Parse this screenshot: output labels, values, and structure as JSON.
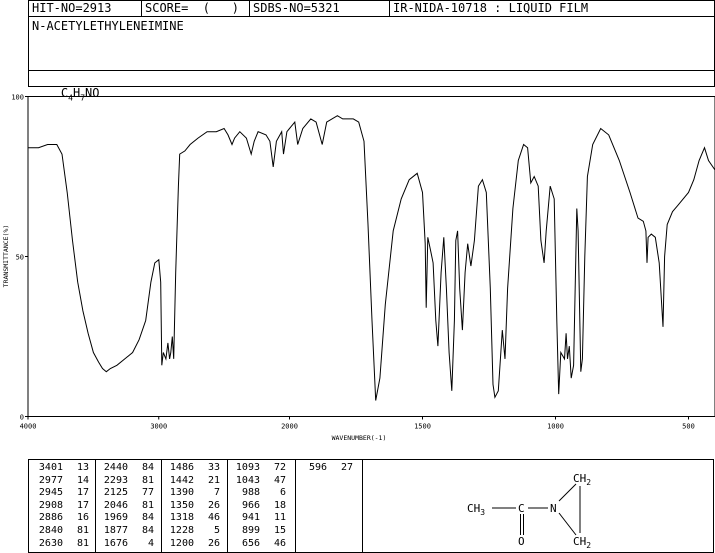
{
  "header": {
    "hit_no": "HIT-NO=2913",
    "score": "SCORE=  (   )",
    "sdbs_no": "SDBS-NO=5321",
    "ir_info": "IR-NIDA-10718 : LIQUID FILM"
  },
  "compound_name": "N-ACETYLETHYLENEIMINE",
  "formula": {
    "c": "C",
    "c_n": "4",
    "h": "H",
    "h_n": "7",
    "rest": "NO"
  },
  "structure": {
    "ch3": "CH",
    "ch3_sub": "3",
    "c": "C",
    "o": "O",
    "n": "N",
    "ch2_top": "CH",
    "ch2_top_sub": "2",
    "ch2_bot": "CH",
    "ch2_bot_sub": "2"
  },
  "chart_data": {
    "type": "line",
    "xlabel": "WAVENUMBER(-1)",
    "ylabel": "TRANSMITTANCE(%)",
    "xlim": [
      4000,
      400
    ],
    "ylim": [
      0,
      100
    ],
    "x_ticks": [
      "4000",
      "3000",
      "2000",
      "1500",
      "1000",
      "500"
    ],
    "y_ticks": [
      "100",
      "50",
      "0"
    ],
    "series": [
      {
        "points": [
          [
            4000,
            84
          ],
          [
            3920,
            84
          ],
          [
            3850,
            85
          ],
          [
            3780,
            85
          ],
          [
            3740,
            82
          ],
          [
            3700,
            70
          ],
          [
            3660,
            55
          ],
          [
            3620,
            42
          ],
          [
            3580,
            33
          ],
          [
            3540,
            26
          ],
          [
            3500,
            20
          ],
          [
            3460,
            17
          ],
          [
            3430,
            15
          ],
          [
            3401,
            14
          ],
          [
            3370,
            15
          ],
          [
            3320,
            16
          ],
          [
            3260,
            18
          ],
          [
            3200,
            20
          ],
          [
            3150,
            24
          ],
          [
            3100,
            30
          ],
          [
            3060,
            42
          ],
          [
            3030,
            48
          ],
          [
            3000,
            49
          ],
          [
            2985,
            42
          ],
          [
            2977,
            16
          ],
          [
            2965,
            20
          ],
          [
            2955,
            19
          ],
          [
            2945,
            18
          ],
          [
            2930,
            23
          ],
          [
            2917,
            18
          ],
          [
            2908,
            20
          ],
          [
            2896,
            25
          ],
          [
            2886,
            18
          ],
          [
            2870,
            45
          ],
          [
            2850,
            72
          ],
          [
            2840,
            82
          ],
          [
            2800,
            83
          ],
          [
            2760,
            85
          ],
          [
            2700,
            87
          ],
          [
            2630,
            89
          ],
          [
            2560,
            89
          ],
          [
            2500,
            90
          ],
          [
            2470,
            88
          ],
          [
            2440,
            85
          ],
          [
            2420,
            87
          ],
          [
            2380,
            89
          ],
          [
            2330,
            87
          ],
          [
            2293,
            82
          ],
          [
            2270,
            86
          ],
          [
            2240,
            89
          ],
          [
            2180,
            88
          ],
          [
            2150,
            86
          ],
          [
            2125,
            78
          ],
          [
            2100,
            86
          ],
          [
            2060,
            89
          ],
          [
            2046,
            82
          ],
          [
            2020,
            89
          ],
          [
            2000,
            90
          ],
          [
            1980,
            92
          ],
          [
            1969,
            85
          ],
          [
            1950,
            90
          ],
          [
            1920,
            93
          ],
          [
            1900,
            92
          ],
          [
            1877,
            85
          ],
          [
            1860,
            92
          ],
          [
            1820,
            94
          ],
          [
            1800,
            93
          ],
          [
            1760,
            93
          ],
          [
            1740,
            92
          ],
          [
            1720,
            86
          ],
          [
            1705,
            60
          ],
          [
            1690,
            30
          ],
          [
            1676,
            5
          ],
          [
            1660,
            12
          ],
          [
            1640,
            35
          ],
          [
            1610,
            58
          ],
          [
            1580,
            68
          ],
          [
            1550,
            74
          ],
          [
            1520,
            76
          ],
          [
            1500,
            70
          ],
          [
            1490,
            54
          ],
          [
            1486,
            34
          ],
          [
            1480,
            56
          ],
          [
            1470,
            52
          ],
          [
            1460,
            48
          ],
          [
            1450,
            30
          ],
          [
            1442,
            22
          ],
          [
            1430,
            45
          ],
          [
            1420,
            56
          ],
          [
            1410,
            40
          ],
          [
            1400,
            20
          ],
          [
            1390,
            8
          ],
          [
            1380,
            30
          ],
          [
            1375,
            55
          ],
          [
            1368,
            58
          ],
          [
            1360,
            40
          ],
          [
            1350,
            27
          ],
          [
            1340,
            45
          ],
          [
            1330,
            54
          ],
          [
            1318,
            47
          ],
          [
            1305,
            55
          ],
          [
            1290,
            72
          ],
          [
            1275,
            74
          ],
          [
            1260,
            70
          ],
          [
            1245,
            40
          ],
          [
            1235,
            10
          ],
          [
            1228,
            6
          ],
          [
            1215,
            8
          ],
          [
            1200,
            27
          ],
          [
            1190,
            18
          ],
          [
            1180,
            40
          ],
          [
            1160,
            65
          ],
          [
            1140,
            80
          ],
          [
            1120,
            85
          ],
          [
            1105,
            84
          ],
          [
            1093,
            73
          ],
          [
            1080,
            75
          ],
          [
            1065,
            72
          ],
          [
            1055,
            55
          ],
          [
            1043,
            48
          ],
          [
            1035,
            58
          ],
          [
            1020,
            72
          ],
          [
            1005,
            68
          ],
          [
            995,
            30
          ],
          [
            988,
            7
          ],
          [
            980,
            20
          ],
          [
            966,
            18
          ],
          [
            960,
            26
          ],
          [
            955,
            18
          ],
          [
            948,
            22
          ],
          [
            941,
            12
          ],
          [
            932,
            16
          ],
          [
            920,
            65
          ],
          [
            915,
            58
          ],
          [
            905,
            14
          ],
          [
            899,
            18
          ],
          [
            890,
            50
          ],
          [
            880,
            75
          ],
          [
            860,
            85
          ],
          [
            830,
            90
          ],
          [
            800,
            88
          ],
          [
            760,
            80
          ],
          [
            720,
            70
          ],
          [
            690,
            62
          ],
          [
            670,
            61
          ],
          [
            660,
            58
          ],
          [
            656,
            48
          ],
          [
            652,
            56
          ],
          [
            640,
            57
          ],
          [
            625,
            56
          ],
          [
            610,
            48
          ],
          [
            596,
            28
          ],
          [
            590,
            50
          ],
          [
            580,
            60
          ],
          [
            560,
            64
          ],
          [
            540,
            66
          ],
          [
            500,
            70
          ],
          [
            480,
            74
          ],
          [
            460,
            80
          ],
          [
            440,
            84
          ],
          [
            425,
            80
          ],
          [
            400,
            77
          ]
        ]
      }
    ]
  },
  "peaks": [
    [
      [
        "3401",
        "13"
      ],
      [
        "2977",
        "14"
      ],
      [
        "2945",
        "17"
      ],
      [
        "2908",
        "17"
      ],
      [
        "2886",
        "16"
      ],
      [
        "2840",
        "81"
      ],
      [
        "2630",
        "81"
      ]
    ],
    [
      [
        "2440",
        "84"
      ],
      [
        "2293",
        "81"
      ],
      [
        "2125",
        "77"
      ],
      [
        "2046",
        "81"
      ],
      [
        "1969",
        "84"
      ],
      [
        "1877",
        "84"
      ],
      [
        "1676",
        "4"
      ]
    ],
    [
      [
        "1486",
        "33"
      ],
      [
        "1442",
        "21"
      ],
      [
        "1390",
        "7"
      ],
      [
        "1350",
        "26"
      ],
      [
        "1318",
        "46"
      ],
      [
        "1228",
        "5"
      ],
      [
        "1200",
        "26"
      ]
    ],
    [
      [
        "1093",
        "72"
      ],
      [
        "1043",
        "47"
      ],
      [
        "988",
        "6"
      ],
      [
        "966",
        "18"
      ],
      [
        "941",
        "11"
      ],
      [
        "899",
        "15"
      ],
      [
        "656",
        "46"
      ]
    ],
    [
      [
        "596",
        "27"
      ]
    ]
  ]
}
